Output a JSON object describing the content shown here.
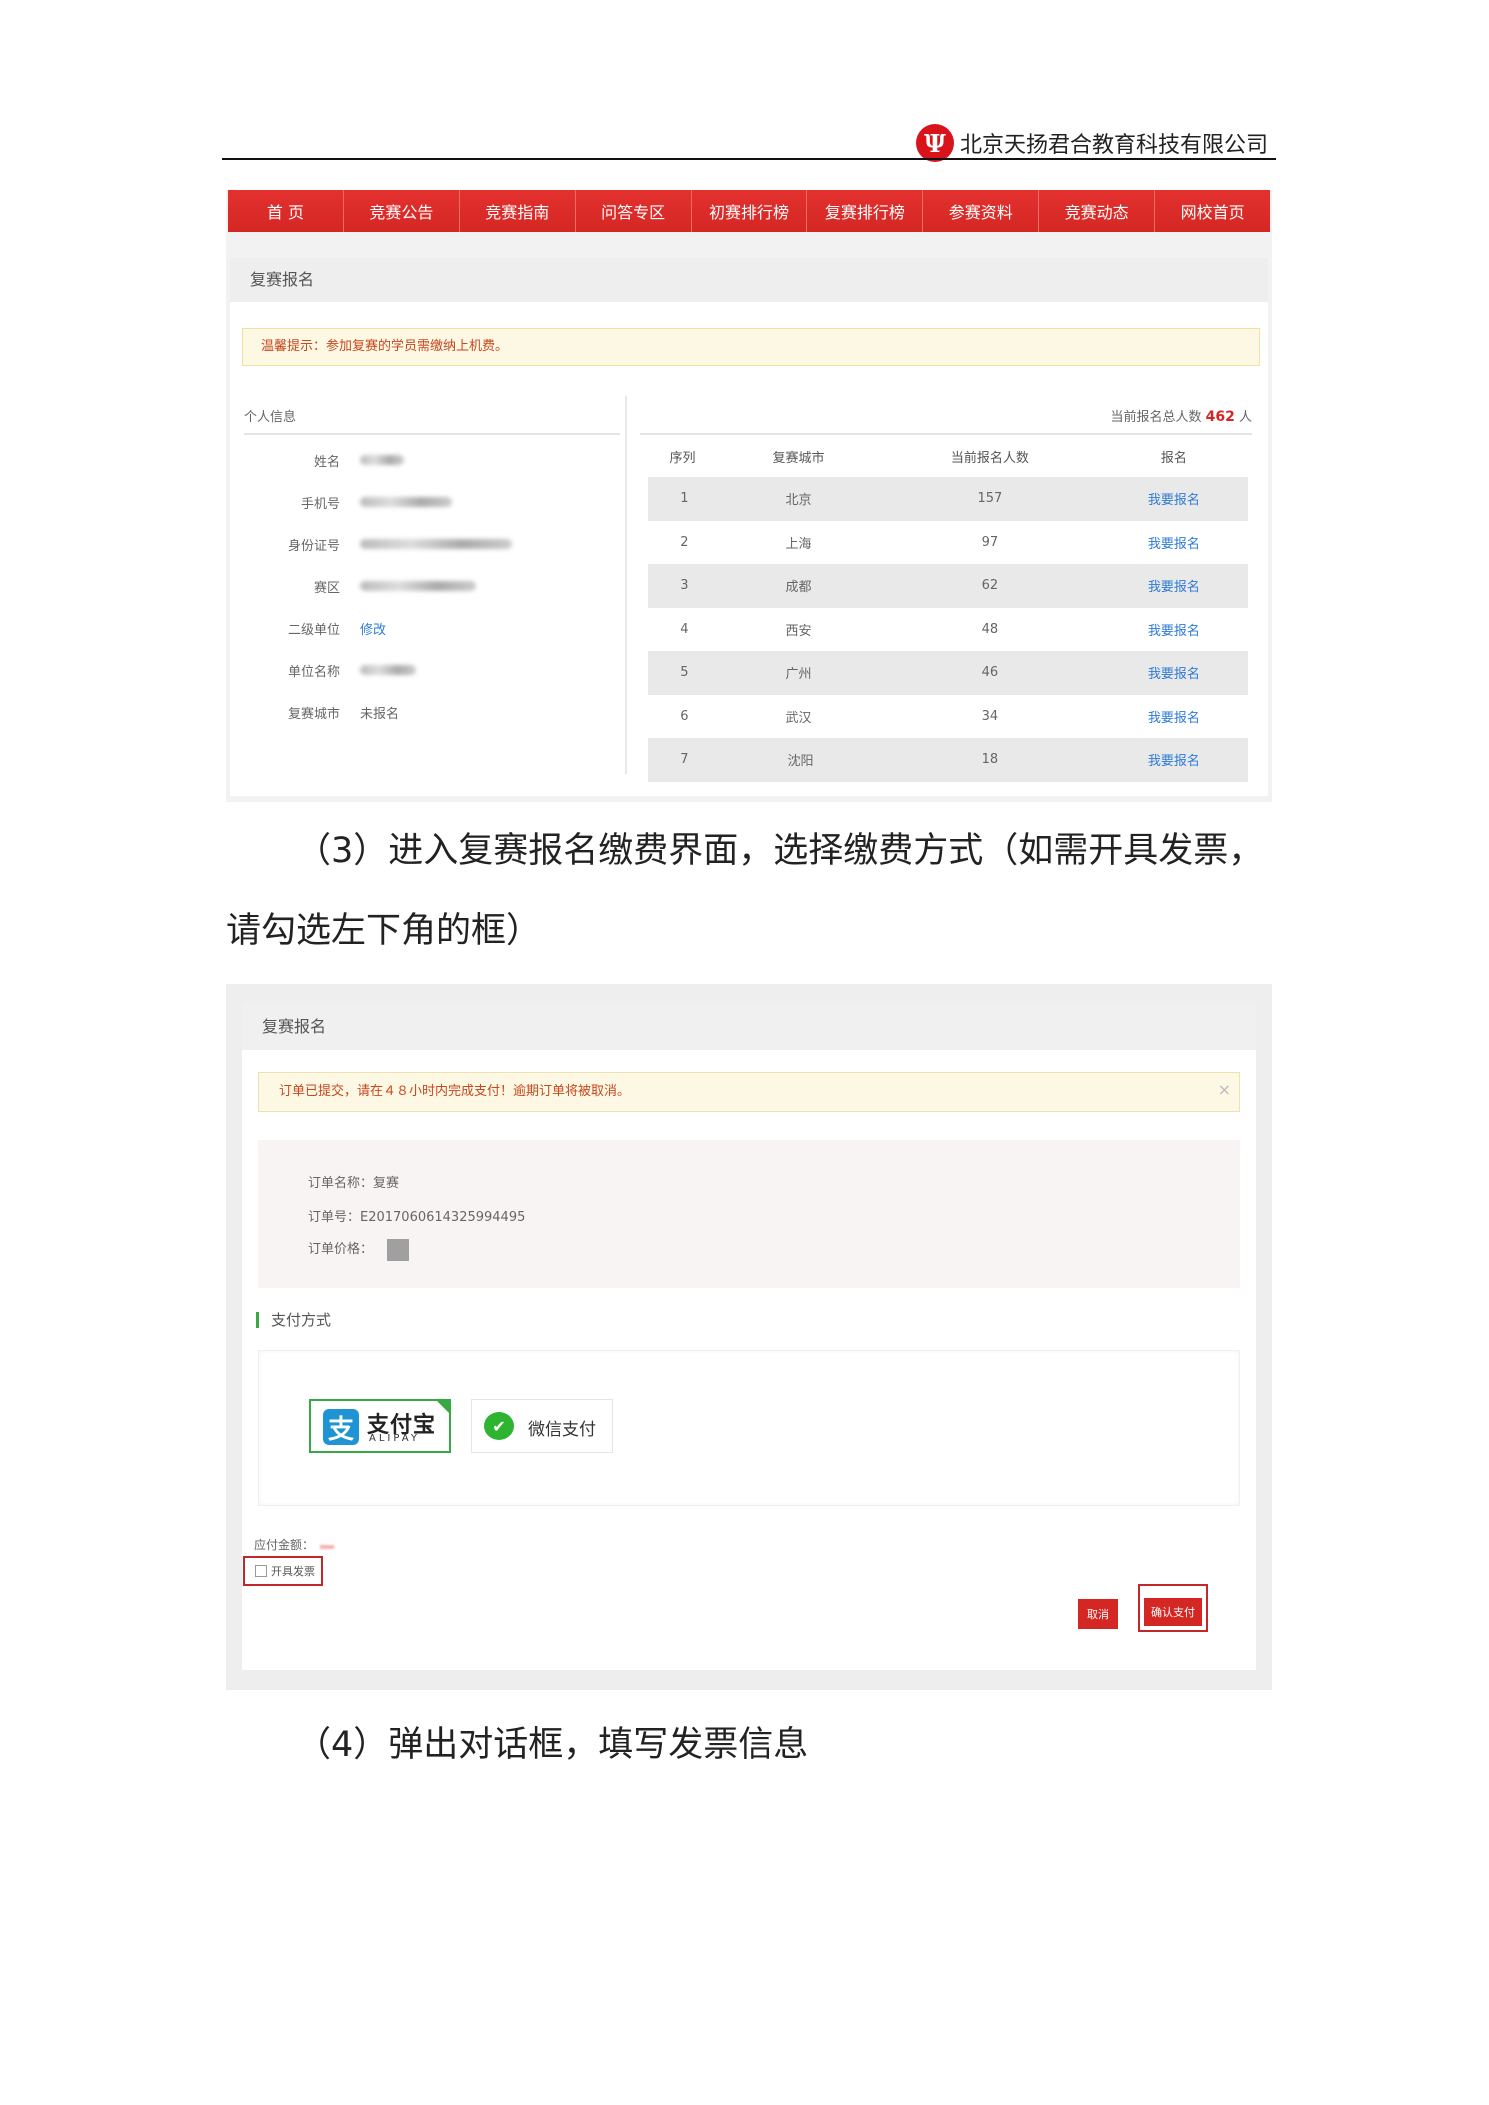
{
  "page_header": {
    "logo_glyph": "Ψ",
    "company": "北京天扬君合教育科技有限公司"
  },
  "screenshot1": {
    "nav": [
      "首 页",
      "竞赛公告",
      "竞赛指南",
      "问答专区",
      "初赛排行榜",
      "复赛排行榜",
      "参赛资料",
      "竞赛动态",
      "网校首页"
    ],
    "panel_title": "复赛报名",
    "tip": "温馨提示：参加复赛的学员需缴纳上机费。",
    "personal": {
      "title": "个人信息",
      "rows": [
        {
          "label": "姓名",
          "value": ""
        },
        {
          "label": "手机号",
          "value": ""
        },
        {
          "label": "身份证号",
          "value": ""
        },
        {
          "label": "赛区",
          "value": ""
        },
        {
          "label": "二级单位",
          "value": "修改"
        },
        {
          "label": "单位名称",
          "value": ""
        },
        {
          "label": "复赛城市",
          "value": "未报名"
        }
      ]
    },
    "total_label": "当前报名总人数",
    "total_count": "462",
    "total_unit": "人",
    "table": {
      "headers": [
        "序列",
        "复赛城市",
        "当前报名人数",
        "报名"
      ],
      "rows": [
        {
          "idx": "1",
          "city": "北京",
          "count": "157",
          "action": "我要报名"
        },
        {
          "idx": "2",
          "city": "上海",
          "count": "97",
          "action": "我要报名"
        },
        {
          "idx": "3",
          "city": "成都",
          "count": "62",
          "action": "我要报名"
        },
        {
          "idx": "4",
          "city": "西安",
          "count": "48",
          "action": "我要报名"
        },
        {
          "idx": "5",
          "city": "广州",
          "count": "46",
          "action": "我要报名"
        },
        {
          "idx": "6",
          "city": "武汉",
          "count": "34",
          "action": "我要报名"
        },
        {
          "idx": "7",
          "city": "沈阳",
          "count": "18",
          "action": "我要报名"
        }
      ]
    }
  },
  "para3_line1": "（3）进入复赛报名缴费界面，选择缴费方式（如需开具发票，",
  "para3_line2": "请勾选左下角的框）",
  "screenshot2": {
    "panel_title": "复赛报名",
    "tip": "订单已提交，请在４８小时内完成支付！逾期订单将被取消。",
    "close": "×",
    "order_name": "订单名称：复赛",
    "order_no": "订单号：E2017060614325994495",
    "order_price_label": "订单价格：",
    "pay_title": "支付方式",
    "alipay_icon": "支",
    "alipay_text": "支付宝",
    "alipay_sub": "ALIPAY",
    "wechat_icon": "✔",
    "wechat_text": "微信支付",
    "due_label": "应付金额：",
    "invoice_label": "开具发票",
    "cancel": "取消",
    "confirm": "确认支付"
  },
  "para4": "（4）弹出对话框，填写发票信息"
}
